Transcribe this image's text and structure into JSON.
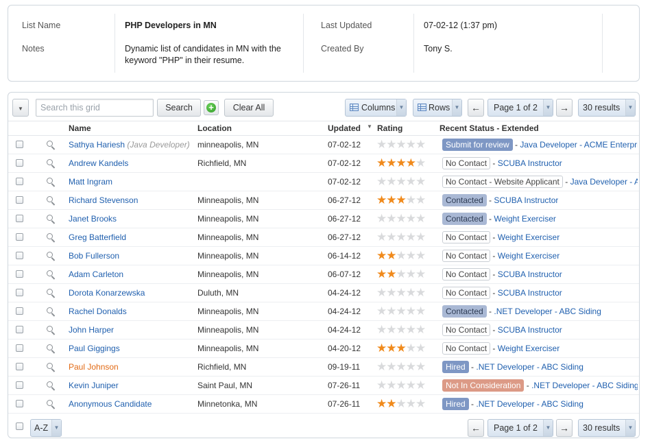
{
  "list_info": {
    "list_name_label": "List Name",
    "list_name": "PHP Developers in MN",
    "notes_label": "Notes",
    "notes_line1": "Dynamic list of candidates in MN with the",
    "notes_line2": "keyword \"PHP\" in their resume.",
    "last_updated_label": "Last Updated",
    "last_updated": "07-02-12 (1:37 pm)",
    "created_by_label": "Created By",
    "created_by": "Tony S."
  },
  "toolbar": {
    "search_placeholder": "Search this grid",
    "search_value": "",
    "search_button": "Search",
    "add_icon": "plus-circle-icon",
    "clear_all": "Clear All",
    "columns": "Columns",
    "rows": "Rows",
    "prev_arrow": "←",
    "next_arrow": "→",
    "page": "Page 1 of 2",
    "results": "30 results",
    "caret": "▼"
  },
  "columns": {
    "name": "Name",
    "location": "Location",
    "updated": "Updated",
    "rating": "Rating",
    "status": "Recent Status - Extended"
  },
  "rows": [
    {
      "name": "Sathya Hariesh",
      "subtitle": "(Java Developer)",
      "location": "minneapolis, MN",
      "updated": "07-02-12",
      "rating": 0,
      "status": "Submit for review",
      "status_type": "review",
      "extended": "Java Developer - ACME Enterprises"
    },
    {
      "name": "Andrew Kandels",
      "location": "Richfield, MN",
      "updated": "07-02-12",
      "rating": 4,
      "status": "No Contact",
      "status_type": "nocontact",
      "extended": "SCUBA Instructor"
    },
    {
      "name": "Matt Ingram",
      "location": "",
      "updated": "07-02-12",
      "rating": 0,
      "status": "No Contact - Website Applicant",
      "status_type": "nocontact",
      "extended": "Java Developer - ACME"
    },
    {
      "name": "Richard Stevenson",
      "location": "Minneapolis, MN",
      "updated": "06-27-12",
      "rating": 3,
      "status": "Contacted",
      "status_type": "contacted",
      "extended": "SCUBA Instructor"
    },
    {
      "name": "Janet Brooks",
      "location": "Minneapolis, MN",
      "updated": "06-27-12",
      "rating": 0,
      "status": "Contacted",
      "status_type": "contacted",
      "extended": "Weight Exerciser"
    },
    {
      "name": "Greg Batterfield",
      "location": "Minneapolis, MN",
      "updated": "06-27-12",
      "rating": 0,
      "status": "No Contact",
      "status_type": "nocontact",
      "extended": "Weight Exerciser"
    },
    {
      "name": "Bob Fullerson",
      "location": "Minneapolis, MN",
      "updated": "06-14-12",
      "rating": 2,
      "status": "No Contact",
      "status_type": "nocontact",
      "extended": "Weight Exerciser"
    },
    {
      "name": "Adam Carleton",
      "location": "Minneapolis, MN",
      "updated": "06-07-12",
      "rating": 2,
      "status": "No Contact",
      "status_type": "nocontact",
      "extended": "SCUBA Instructor"
    },
    {
      "name": "Dorota Konarzewska",
      "location": "Duluth, MN",
      "updated": "04-24-12",
      "rating": 0,
      "status": "No Contact",
      "status_type": "nocontact",
      "extended": "SCUBA Instructor"
    },
    {
      "name": "Rachel Donalds",
      "location": "Minneapolis, MN",
      "updated": "04-24-12",
      "rating": 0,
      "status": "Contacted",
      "status_type": "contacted",
      "extended": ".NET Developer - ABC Siding"
    },
    {
      "name": "John Harper",
      "location": "Minneapolis, MN",
      "updated": "04-24-12",
      "rating": 0,
      "status": "No Contact",
      "status_type": "nocontact",
      "extended": "SCUBA Instructor"
    },
    {
      "name": "Paul Giggings",
      "location": "Minneapolis, MN",
      "updated": "04-20-12",
      "rating": 3,
      "status": "No Contact",
      "status_type": "nocontact",
      "extended": "Weight Exerciser"
    },
    {
      "name": "Paul Johnson",
      "highlight": true,
      "location": "Richfield, MN",
      "updated": "09-19-11",
      "rating": 0,
      "status": "Hired",
      "status_type": "hired",
      "extended": ".NET Developer - ABC Siding"
    },
    {
      "name": "Kevin Juniper",
      "location": "Saint Paul, MN",
      "updated": "07-26-11",
      "rating": 0,
      "status": "Not In Consideration",
      "status_type": "notin",
      "extended": ".NET Developer - ABC Siding"
    },
    {
      "name": "Anonymous Candidate",
      "location": "Minnetonka, MN",
      "updated": "07-26-11",
      "rating": 2,
      "status": "Hired",
      "status_type": "hired",
      "extended": ".NET Developer - ABC Siding"
    }
  ],
  "footer": {
    "sort": "A-Z",
    "page": "Page 1 of 2",
    "results": "30 results",
    "prev_arrow": "←",
    "next_arrow": "→",
    "caret": "▼"
  }
}
